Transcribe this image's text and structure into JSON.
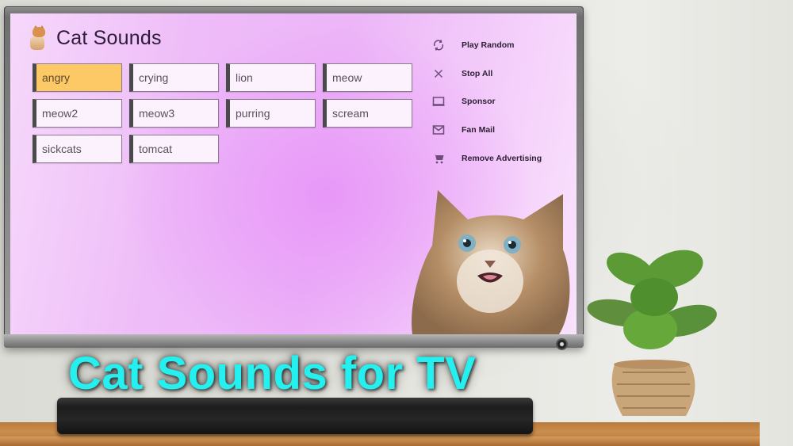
{
  "app": {
    "title": "Cat Sounds",
    "logo_icon": "kitten-logo-icon"
  },
  "sounds": [
    {
      "label": "angry",
      "selected": true
    },
    {
      "label": "crying",
      "selected": false
    },
    {
      "label": "lion",
      "selected": false
    },
    {
      "label": "meow",
      "selected": false
    },
    {
      "label": "meow2",
      "selected": false
    },
    {
      "label": "meow3",
      "selected": false
    },
    {
      "label": "purring",
      "selected": false
    },
    {
      "label": "scream",
      "selected": false
    },
    {
      "label": "sickcats",
      "selected": false
    },
    {
      "label": "tomcat",
      "selected": false
    }
  ],
  "menu": [
    {
      "label": "Play Random",
      "icon": "shuffle-refresh-icon"
    },
    {
      "label": "Stop All",
      "icon": "close-icon"
    },
    {
      "label": "Sponsor",
      "icon": "laptop-icon"
    },
    {
      "label": "Fan Mail",
      "icon": "mail-icon"
    },
    {
      "label": "Remove Advertising",
      "icon": "cart-icon"
    }
  ],
  "promo": {
    "headline": "Cat Sounds for TV"
  },
  "colors": {
    "selected_button": "#fdc866",
    "button_background": "#fcf2fd",
    "button_accent_bar": "#4a4a4a",
    "screen_background": "#ecb6f7",
    "headline": "#24f0ef",
    "menu_icon": "#6b4d78"
  }
}
